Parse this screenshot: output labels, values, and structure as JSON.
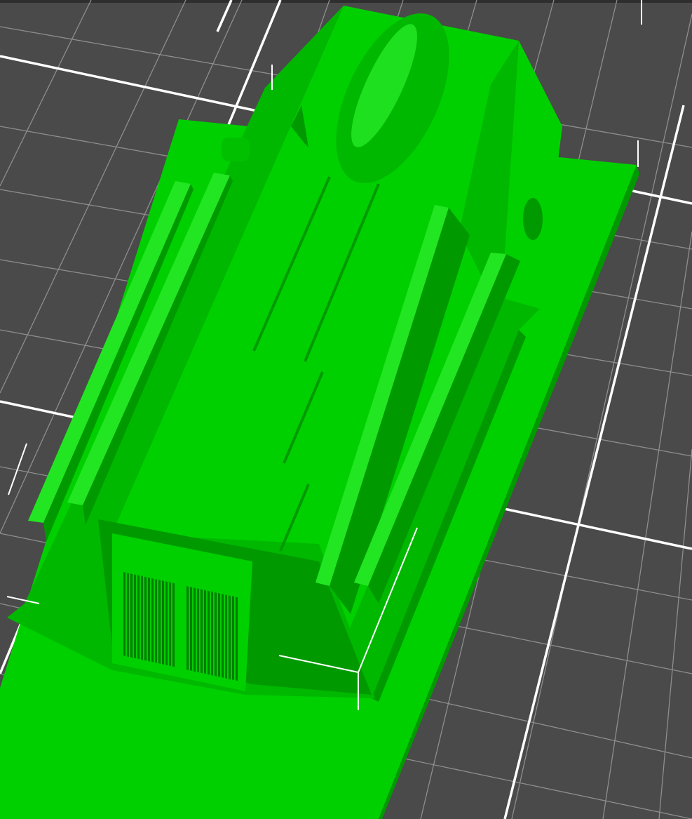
{
  "viewport": {
    "background_color": "#4a4a4a",
    "top_edge_color": "#2e2e2e"
  },
  "build_plate": {
    "fine_grid_color": "#8e8e8e",
    "major_grid_color": "#ffffff"
  },
  "model": {
    "base_color": "#00d000",
    "light_color": "#22e622",
    "mid_color": "#00b800",
    "dark_color": "#009a00",
    "deep_color": "#007e00"
  },
  "bounding_box": {
    "color": "#ffffff"
  }
}
